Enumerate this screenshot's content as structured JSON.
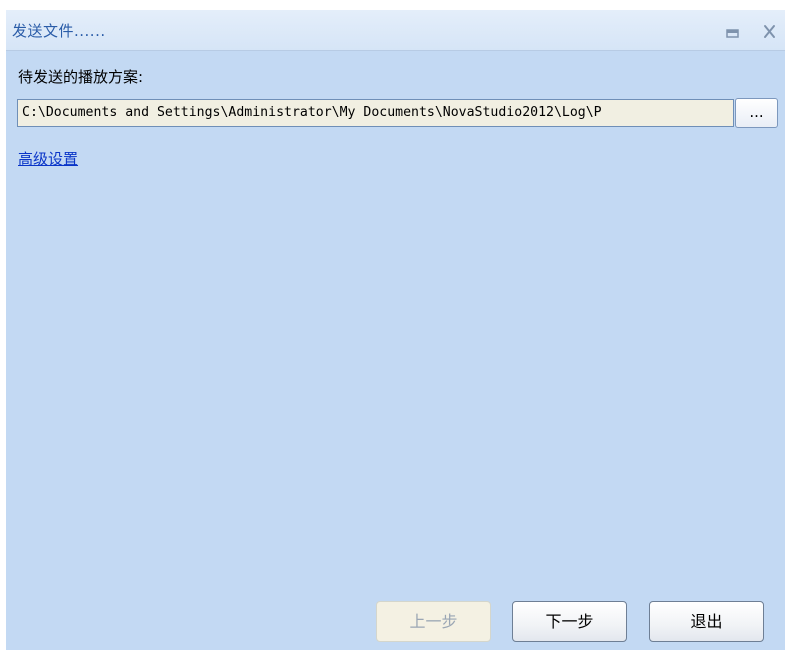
{
  "window": {
    "title": "发送文件......"
  },
  "form": {
    "pending_label": "待发送的播放方案:",
    "path_value": "C:\\Documents and Settings\\Administrator\\My Documents\\NovaStudio2012\\Log\\P",
    "browse_label": "...",
    "advanced_link": "高级设置"
  },
  "buttons": {
    "prev": "上一步",
    "next": "下一步",
    "exit": "退出"
  },
  "icons": {
    "minimize": "minimize-icon",
    "close": "close-icon"
  },
  "colors": {
    "background": "#c3d9f3",
    "title_text": "#2a5ca8",
    "link": "#0a35c8",
    "input_bg": "#f1efe2"
  }
}
